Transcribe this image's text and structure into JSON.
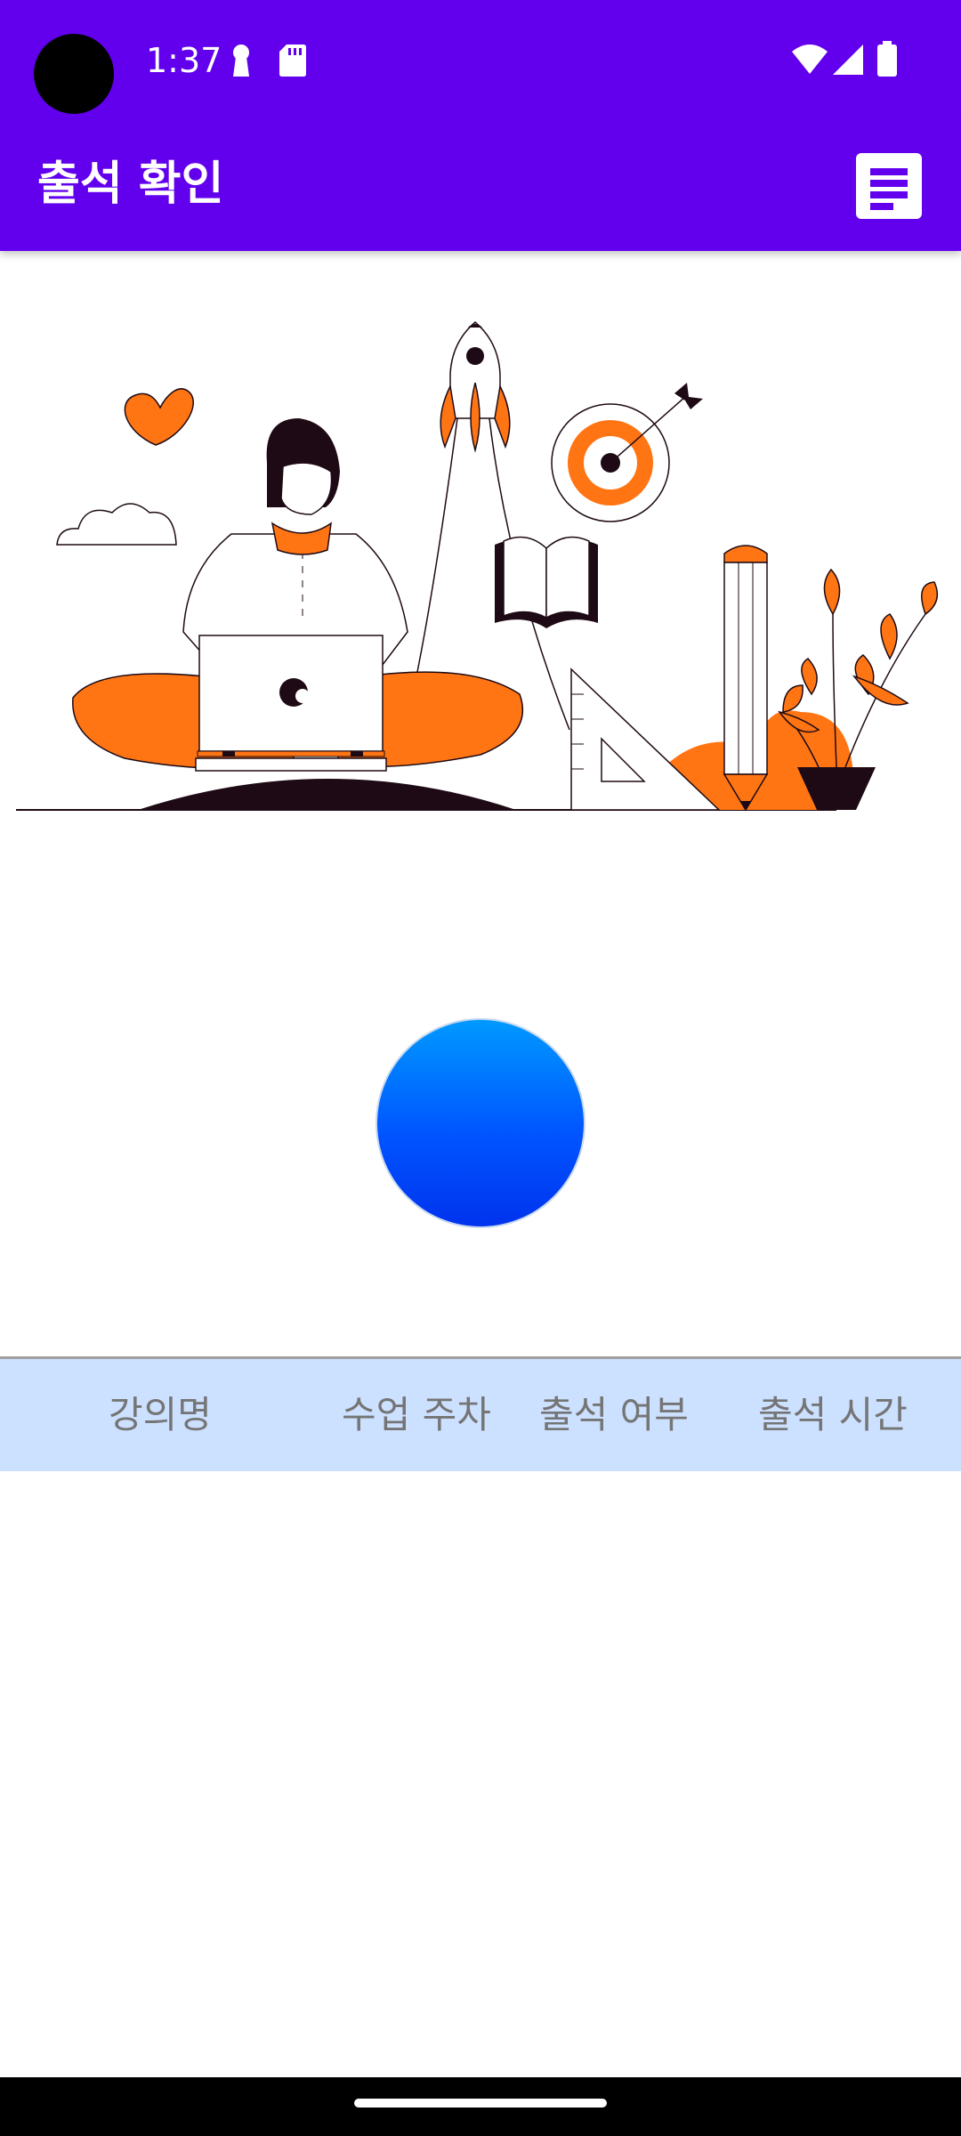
{
  "status_bar": {
    "time": "1:37",
    "background": "#6200ee",
    "left_icons": [
      "keyhole-icon",
      "sd-card-icon"
    ],
    "right_icons": [
      "wifi-icon",
      "cellular-signal-icon",
      "battery-icon"
    ]
  },
  "app_bar": {
    "title": "출석 확인",
    "menu_icon": "list-menu-icon",
    "background": "#6200ee"
  },
  "illustration": {
    "subject": "person-with-laptop-study-illustration",
    "accent_color": "#ff7514",
    "dark_color": "#1e0a14"
  },
  "scan_button": {
    "icon": "blue-circle-button",
    "gradient_top": "#0099ff",
    "gradient_bottom": "#0033ee"
  },
  "attendance_table": {
    "header_background": "#cce0ff",
    "columns": [
      "강의명",
      "수업 주차",
      "출석 여부",
      "출석 시간"
    ],
    "rows": []
  }
}
